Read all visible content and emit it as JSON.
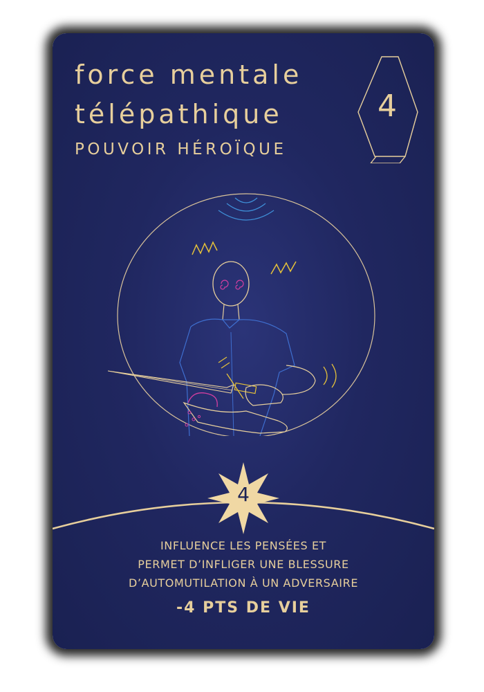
{
  "card": {
    "title_line1": "force mentale",
    "title_line2": "télépathique",
    "type": "POUVOIR HÉROÏQUE",
    "cost": "4",
    "power": "4",
    "effect_lines": [
      "INFLUENCE LES PENSÉES ET",
      "PERMET D’INFLIGER UNE BLESSURE",
      "D’AUTOMUTILATION À UN ADVERSAIRE"
    ],
    "damage": "-4 PTS DE VIE"
  },
  "colors": {
    "background": "#1f265c",
    "gold": "#e7cf9c",
    "line_blue": "#3f6fd0",
    "accent_yellow": "#e6c23a",
    "accent_magenta": "#d43fa0"
  },
  "icons": {
    "cost": "gem-icon",
    "power": "eight-point-star-icon",
    "illustration": "hypnotized-swordsman-illustration"
  }
}
